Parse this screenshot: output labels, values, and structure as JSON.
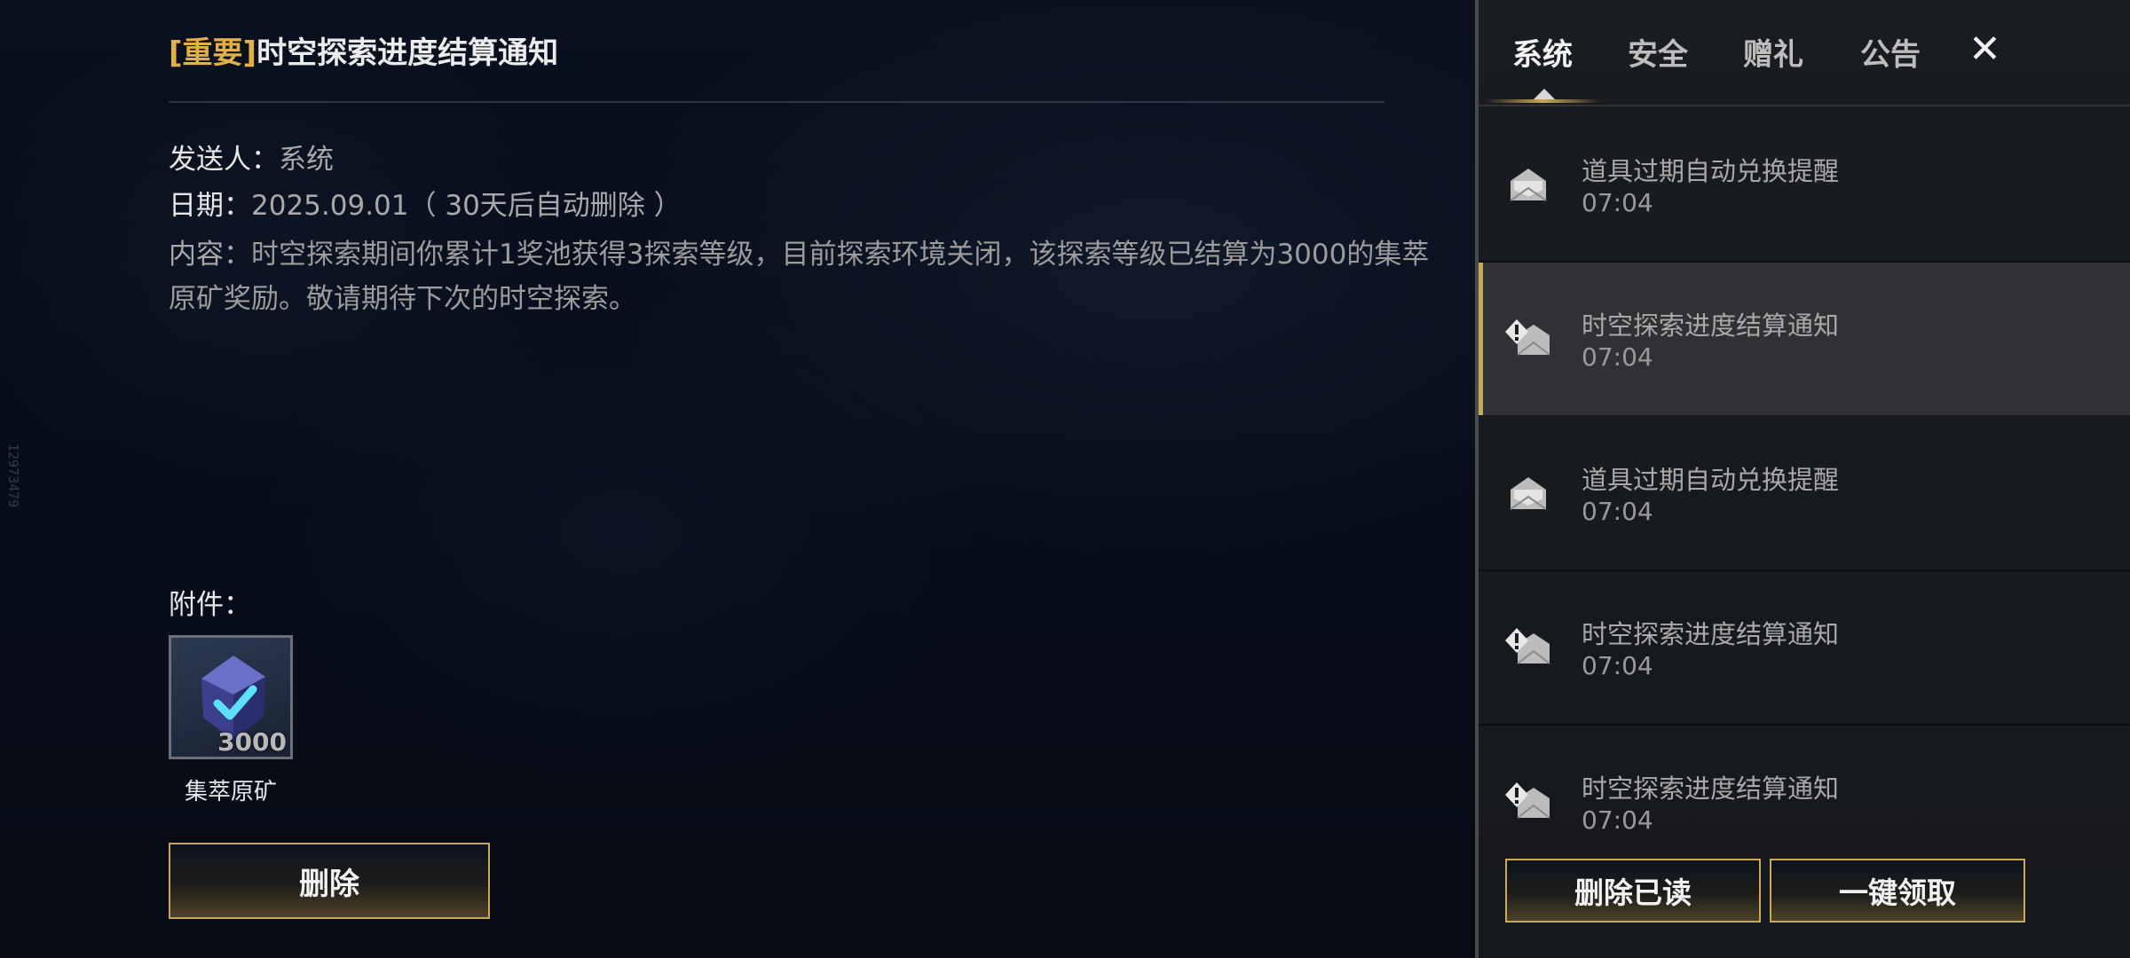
{
  "watermark": "12973479",
  "mail": {
    "title_tag": "[重要]",
    "title": "时空探索进度结算通知",
    "sender_label": "发送人：",
    "sender_value": "系统",
    "date_label": "日期：",
    "date_value": "2025.09.01（ 30天后自动删除 ）",
    "content_label": "内容：",
    "content_text": "时空探索期间你累计1奖池获得3探索等级，目前探索环境关闭，该探索等级已结算为3000的集萃原矿奖励。敬请期待下次的时空探索。",
    "attachment_label": "附件：",
    "attachment": {
      "name": "集萃原矿",
      "count": "3000",
      "icon": "crystal-ore-icon"
    },
    "delete_button": "删除"
  },
  "panel": {
    "tabs": [
      {
        "label": "系统",
        "active": true
      },
      {
        "label": "安全",
        "active": false
      },
      {
        "label": "赠礼",
        "active": false
      },
      {
        "label": "公告",
        "active": false
      }
    ],
    "close_icon": "close-icon",
    "items": [
      {
        "title": "道具过期自动兑换提醒",
        "time": "07:04",
        "icon": "mail-read-icon",
        "selected": false
      },
      {
        "title": "时空探索进度结算通知",
        "time": "07:04",
        "icon": "mail-important-icon",
        "selected": true
      },
      {
        "title": "道具过期自动兑换提醒",
        "time": "07:04",
        "icon": "mail-read-icon",
        "selected": false
      },
      {
        "title": "时空探索进度结算通知",
        "time": "07:04",
        "icon": "mail-important-icon",
        "selected": false
      },
      {
        "title": "时空探索进度结算通知",
        "time": "07:04",
        "icon": "mail-important-icon",
        "selected": false
      }
    ],
    "delete_read_button": "删除已读",
    "claim_all_button": "一键领取"
  },
  "colors": {
    "accent_gold": "#c9a85a",
    "tag_gold": "#e2b04a"
  }
}
